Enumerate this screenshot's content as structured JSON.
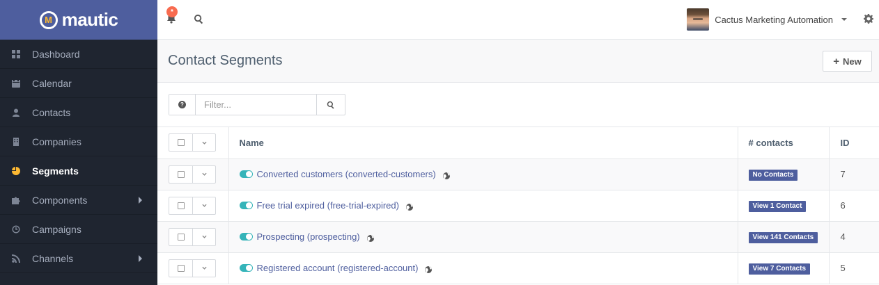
{
  "brand": {
    "name": "mautic",
    "mark": "M"
  },
  "sidebar": {
    "items": [
      {
        "label": "Dashboard",
        "icon": "dashboard-icon"
      },
      {
        "label": "Calendar",
        "icon": "calendar-icon"
      },
      {
        "label": "Contacts",
        "icon": "user-icon"
      },
      {
        "label": "Companies",
        "icon": "building-icon"
      },
      {
        "label": "Segments",
        "icon": "pie-chart-icon",
        "active": true
      },
      {
        "label": "Components",
        "icon": "puzzle-icon",
        "submenu": true
      },
      {
        "label": "Campaigns",
        "icon": "clock-icon"
      },
      {
        "label": "Channels",
        "icon": "rss-icon",
        "submenu": true
      }
    ]
  },
  "topbar": {
    "notification_badge": "*",
    "user_name": "Cactus Marketing Automation"
  },
  "page": {
    "title": "Contact Segments",
    "new_button": "New",
    "new_button_icon": "+"
  },
  "filter": {
    "help_icon": "?",
    "placeholder": "Filter..."
  },
  "table": {
    "headers": {
      "name": "Name",
      "contacts": "# contacts",
      "id": "ID"
    },
    "rows": [
      {
        "name": "Converted customers (converted-customers)",
        "contacts": "No Contacts",
        "id": "7"
      },
      {
        "name": "Free trial expired (free-trial-expired)",
        "contacts": "View 1 Contact",
        "id": "6"
      },
      {
        "name": "Prospecting (prospecting)",
        "contacts": "View 141 Contacts",
        "id": "4"
      },
      {
        "name": "Registered account (registered-account)",
        "contacts": "View 7 Contacts",
        "id": "5"
      }
    ]
  },
  "colors": {
    "sidebar_bg": "#1f2530",
    "brand_bg": "#4e5e9e",
    "accent": "#4e5e9e",
    "toggle_on": "#35b4b9",
    "notification": "#f86b4f",
    "active_icon": "#fdb933"
  }
}
